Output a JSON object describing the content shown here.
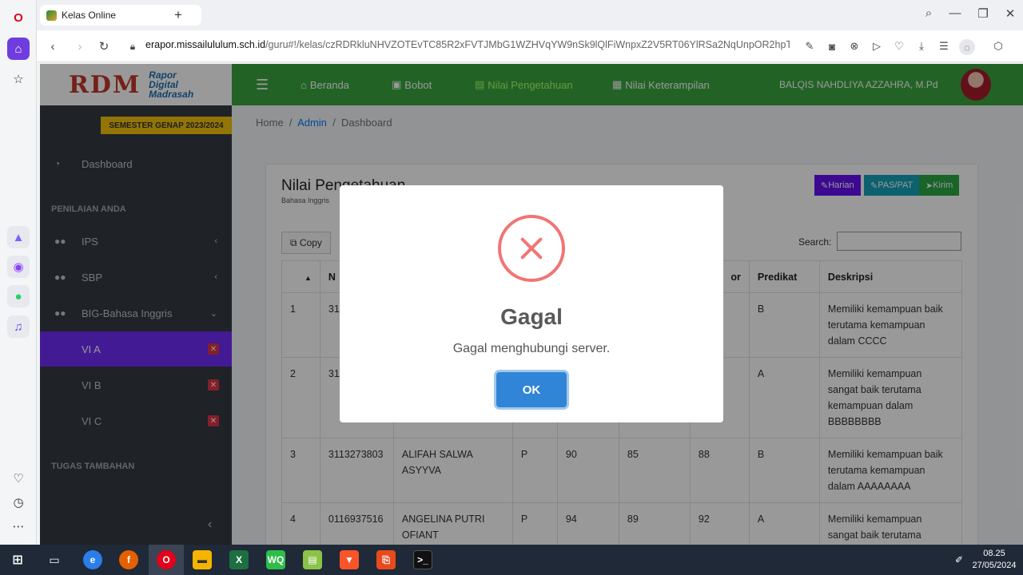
{
  "browser": {
    "tab_title": "Kelas Online",
    "new_tab": "+",
    "url_host": "erapor.missailululum.sch.id",
    "url_prefix": "",
    "url_path": "/guru#!/kelas/czRDRkluNHVZOTEvTC85R2xFVTJMbG1WZHVqYW9nSk9lQlFiWnpxZ2V5RT06YlRSa2NqUnpOR2hpTVhNMFpl"
  },
  "sidebar": {
    "brand_mark": "RDM",
    "brand_line1": "Rapor",
    "brand_line2": "Digital",
    "brand_line3": "Madrasah",
    "semester": "SEMESTER GENAP 2023/2024",
    "dashboard": "Dashboard",
    "section_penilaian": "PENILAIAN ANDA",
    "items": [
      {
        "label": "IPS"
      },
      {
        "label": "SBP"
      },
      {
        "label": "BIG-Bahasa Inggris"
      }
    ],
    "classes": [
      {
        "label": "VI A"
      },
      {
        "label": "VI B"
      },
      {
        "label": "VI C"
      }
    ],
    "section_tugas": "TUGAS TAMBAHAN"
  },
  "topnav": {
    "beranda": "Beranda",
    "bobot": "Bobot",
    "nilai_pengetahuan": "Nilai Pengetahuan",
    "nilai_keterampilan": "Nilai Keterampilan",
    "user": "BALQIS NAHDLIYA AZZAHRA, M.Pd"
  },
  "breadcrumb": {
    "home": "Home",
    "admin": "Admin",
    "current": "Dashboard",
    "sep": "/"
  },
  "card": {
    "title": "Nilai Pengetahuan",
    "subtitle": "Bahasa Inggris",
    "btn_harian": "Harian",
    "btn_pas": "PAS/PAT",
    "btn_kirim": "Kirim",
    "copy": "Copy",
    "search_label": "Search:"
  },
  "table": {
    "headers": [
      "",
      "N",
      "",
      "",
      "",
      "",
      "or",
      "Predikat",
      "Deskripsi"
    ],
    "rows": [
      {
        "no": "1",
        "nisn": "312",
        "nama": "",
        "jk": "",
        "h": "",
        "p": "",
        "n": "",
        "predikat": "B",
        "deskripsi": "Memiliki kemampuan baik terutama kemampuan dalam CCCC"
      },
      {
        "no": "2",
        "nisn": "311",
        "nama": "",
        "jk": "",
        "h": "",
        "p": "",
        "n": "",
        "predikat": "A",
        "deskripsi": "Memiliki kemampuan sangat baik terutama kemampuan dalam BBBBBBBB"
      },
      {
        "no": "3",
        "nisn": "3113273803",
        "nama": "ALIFAH SALWA ASYYVA",
        "jk": "P",
        "h": "90",
        "p": "85",
        "n": "88",
        "predikat": "B",
        "deskripsi": "Memiliki kemampuan baik terutama kemampuan dalam AAAAAAAA"
      },
      {
        "no": "4",
        "nisn": "0116937516",
        "nama": "ANGELINA PUTRI OFIANT",
        "jk": "P",
        "h": "94",
        "p": "89",
        "n": "92",
        "predikat": "A",
        "deskripsi": "Memiliki kemampuan sangat baik terutama kemampuan dalam CCCC"
      }
    ]
  },
  "modal": {
    "title": "Gagal",
    "message": "Gagal menghubungi server.",
    "ok": "OK"
  },
  "taskbar": {
    "time": "08.25",
    "date": "27/05/2024"
  },
  "colors": {
    "accent": "#6f2cf5",
    "topnav": "#3aa53f",
    "error": "#f27474",
    "ok_button": "#3085d6"
  }
}
